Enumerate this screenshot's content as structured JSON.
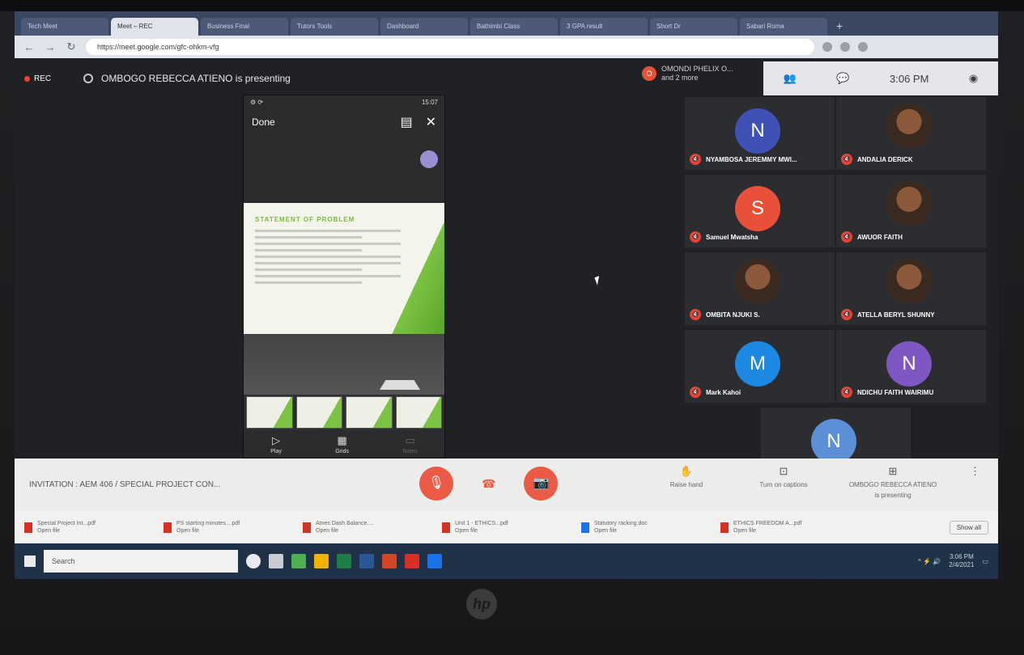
{
  "browser": {
    "tabs": [
      "Tech Meet",
      "Meet – REC",
      "Business Final",
      "Tutors Tools",
      "Dashboard",
      "Bathimbi Class",
      "3 GPA result",
      "Short Dr",
      "Sabari Roma"
    ],
    "url": "https://meet.google.com/gfc-ohkm-vfg"
  },
  "meet": {
    "rec_label": "REC",
    "presenting_text": "OMBOGO REBECCA ATIENO is presenting",
    "joined_avatar": "O",
    "joined_name": "OMONDI PHELIX O...",
    "joined_more": "and 2 more",
    "clock": "3:06 PM"
  },
  "phone": {
    "status_left": "⚙ ⟳",
    "status_right": "15:07",
    "done": "Done",
    "slide_title": "STATEMENT OF PROBLEM",
    "nav": [
      {
        "icon": "▷",
        "label": "Play"
      },
      {
        "icon": "▦",
        "label": "Grids"
      },
      {
        "icon": "▭",
        "label": "Notes"
      }
    ]
  },
  "participants": [
    {
      "initial": "N",
      "name": "NYAMBOSA JEREMMY MWI...",
      "color": "#3f51b5",
      "photo": false
    },
    {
      "initial": "",
      "name": "ANDALIA DERICK",
      "color": "",
      "photo": true
    },
    {
      "initial": "S",
      "name": "Samuel Mwatsha",
      "color": "#e8503a",
      "photo": false
    },
    {
      "initial": "",
      "name": "AWUOR FAITH",
      "color": "",
      "photo": true
    },
    {
      "initial": "",
      "name": "OMBITA NJUKI S.",
      "color": "",
      "photo": true
    },
    {
      "initial": "",
      "name": "ATELLA BERYL SHUNNY",
      "color": "",
      "photo": true
    },
    {
      "initial": "M",
      "name": "Mark Kahoi",
      "color": "#1e88e5",
      "photo": false
    },
    {
      "initial": "N",
      "name": "NDICHU FAITH WAIRIMU",
      "color": "#7e57c2",
      "photo": false
    },
    {
      "initial": "N",
      "name": "NYAMBOSA JEREMMY MWI...",
      "color": "#5c8fd6",
      "photo": false
    }
  ],
  "bottombar": {
    "meeting_title": "INVITATION : AEM 406 / SPECIAL PROJECT CON...",
    "raise_hand": "Raise hand",
    "captions": "Turn on captions",
    "presenting_1": "OMBOGO REBECCA ATIENO",
    "presenting_2": "is presenting"
  },
  "downloads": {
    "items": [
      {
        "name": "Special Project Int...pdf",
        "sub": "Open file"
      },
      {
        "name": "PS starting minutes....pdf",
        "sub": "Open file"
      },
      {
        "name": "Atnes Dash Balance....",
        "sub": "Open file"
      },
      {
        "name": "Unit 1 - ETHICS...pdf",
        "sub": "Open file"
      },
      {
        "name": "Statutory racking.doc",
        "sub": "Open file"
      },
      {
        "name": "ETHICS FREEDOM A...pdf",
        "sub": "Open file"
      }
    ],
    "show_all": "Show all"
  },
  "taskbar": {
    "search": "Search",
    "time": "3:06 PM",
    "date": "2/4/2021"
  },
  "brand": "hp"
}
